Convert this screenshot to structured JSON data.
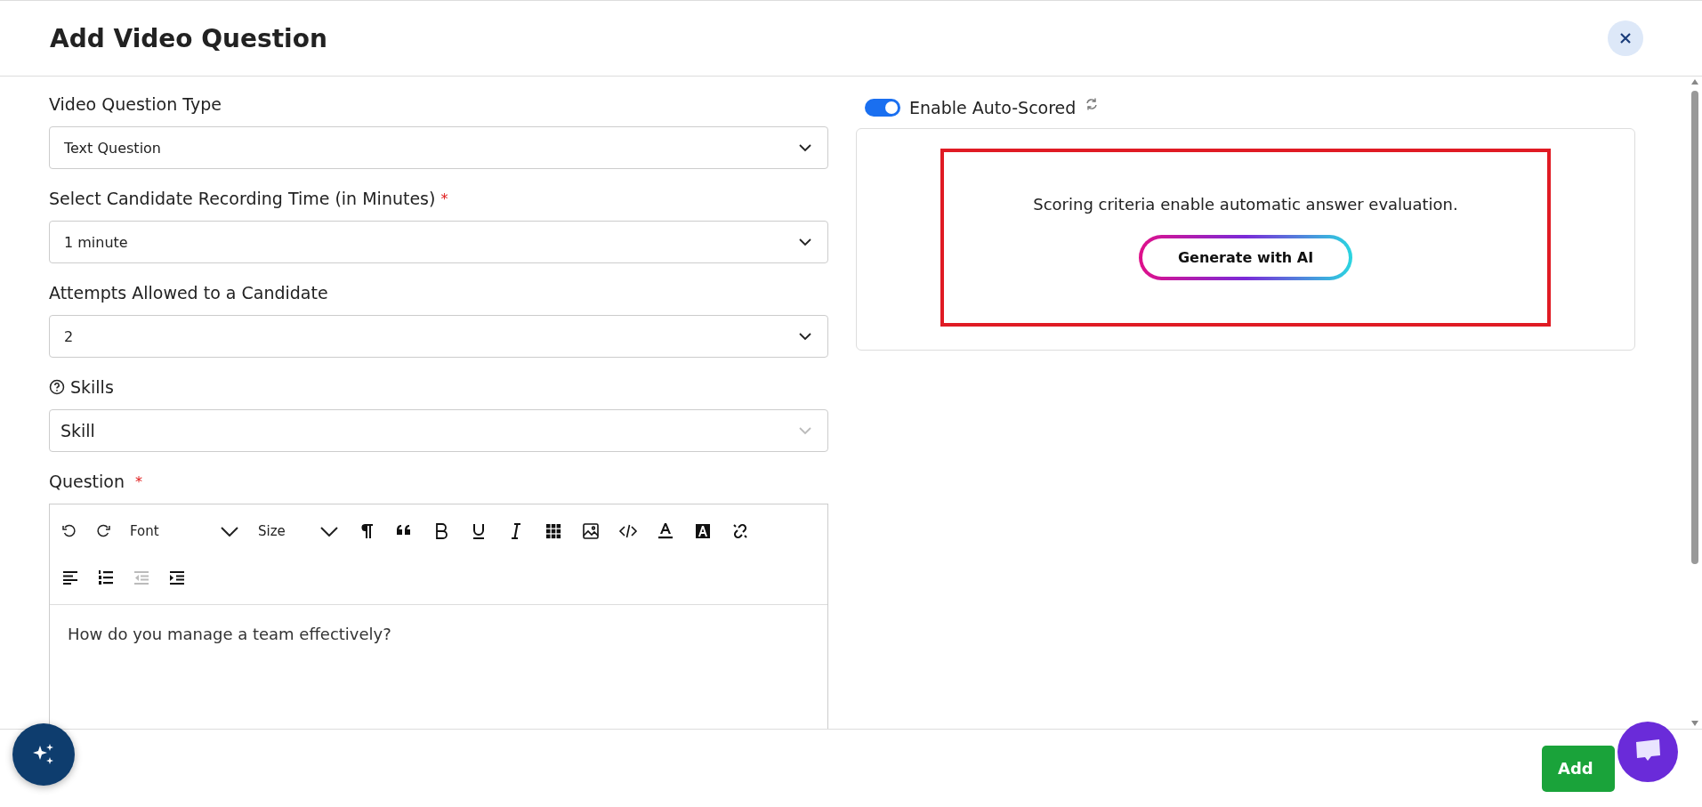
{
  "dialog": {
    "title": "Add Video Question"
  },
  "fields": [
    {
      "label": "Video Question Type",
      "value": "Text Question"
    },
    {
      "label": "Select Candidate Recording Time (in Minutes)",
      "required_mark": "*",
      "value": "1 minute"
    },
    {
      "label": "Attempts Allowed to a Candidate",
      "value": "2"
    },
    {
      "label": "Skills",
      "help": true,
      "placeholder": "Skill"
    }
  ],
  "question": {
    "label": "Question",
    "required_mark": "*",
    "font_select": "Font",
    "size_select": "Size",
    "tools": [
      {
        "kind": "paragraph"
      },
      {
        "kind": "quote"
      },
      {
        "kind": "bold"
      },
      {
        "kind": "underline"
      },
      {
        "kind": "italic"
      },
      {
        "kind": "table"
      },
      {
        "kind": "image"
      },
      {
        "kind": "code"
      },
      {
        "kind": "font-color"
      },
      {
        "kind": "highlight"
      },
      {
        "kind": "unlink"
      }
    ],
    "tools_row2": [
      {
        "kind": "align-left",
        "disabled": false
      },
      {
        "kind": "ordered-list",
        "disabled": false
      },
      {
        "kind": "outdent",
        "disabled": true
      },
      {
        "kind": "indent",
        "disabled": false
      }
    ],
    "content": "How do you manage a team effectively?"
  },
  "auto_score": {
    "on": true,
    "label": "Enable Auto-Scored",
    "message": "Scoring criteria enable automatic answer evaluation.",
    "button": "Generate with AI"
  },
  "footer": {
    "button": "Add"
  }
}
